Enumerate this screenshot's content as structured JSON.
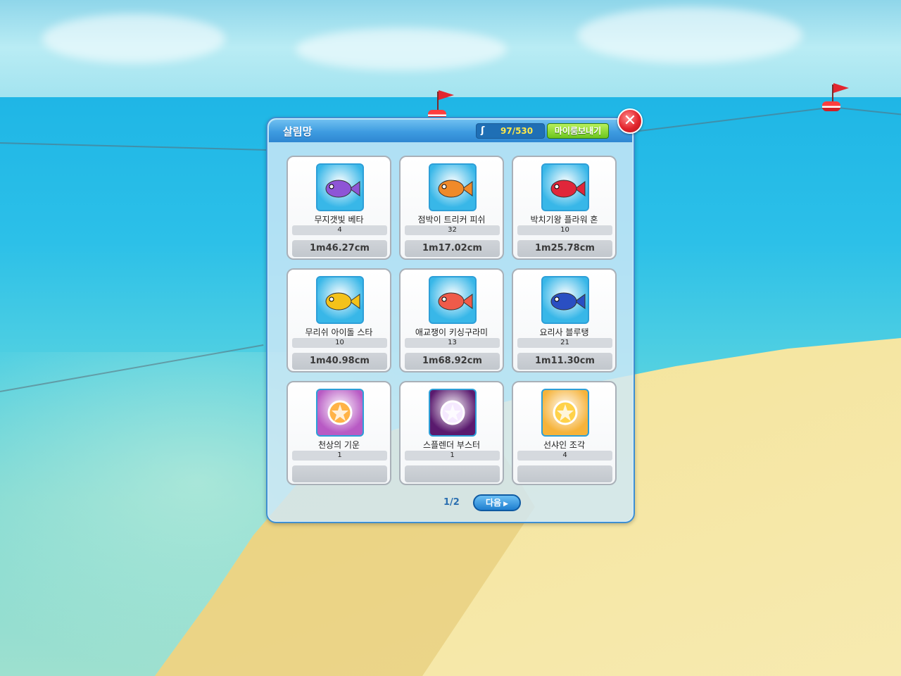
{
  "dialog": {
    "title": "살림망",
    "counter_icon": "hook-icon",
    "counter_text": "97/530",
    "send_button_label": "마이룸보내기",
    "close_icon": "close-icon"
  },
  "items": [
    {
      "name": "무지갯빛 베타",
      "count": "4",
      "size": "1m46.27cm",
      "icon": "betta-fish-icon",
      "bg": "#38b7e8",
      "fish": "#8e55d6"
    },
    {
      "name": "점박이 트리커 피쉬",
      "count": "32",
      "size": "1m17.02cm",
      "icon": "trigger-fish-icon",
      "bg": "#38b7e8",
      "fish": "#f08a2a"
    },
    {
      "name": "박치기왕 플라워 혼",
      "count": "10",
      "size": "1m25.78cm",
      "icon": "flowerhorn-fish-icon",
      "bg": "#38b7e8",
      "fish": "#e0263a"
    },
    {
      "name": "무리쉬 아이돌 스타",
      "count": "10",
      "size": "1m40.98cm",
      "icon": "angelfish-icon",
      "bg": "#38b7e8",
      "fish": "#f4c21a"
    },
    {
      "name": "애교쟁이 키싱구라미",
      "count": "13",
      "size": "1m68.92cm",
      "icon": "kissing-gourami-icon",
      "bg": "#38b7e8",
      "fish": "#ef5b4a"
    },
    {
      "name": "요리사 블루탱",
      "count": "21",
      "size": "1m11.30cm",
      "icon": "blue-tang-icon",
      "bg": "#38b7e8",
      "fish": "#2a4fc2"
    },
    {
      "name": "천상의 기운",
      "count": "1",
      "size": "",
      "icon": "celestial-orb-icon",
      "bg": "#b85ac4",
      "fish": "#ffb347"
    },
    {
      "name": "스플렌더 부스터",
      "count": "1",
      "size": "",
      "icon": "wing-booster-icon",
      "bg": "#5a1a6e",
      "fish": "#f5e9ff"
    },
    {
      "name": "선샤인 조각",
      "count": "4",
      "size": "",
      "icon": "sunshine-piece-icon",
      "bg": "#f6b33a",
      "fish": "#ffd24a"
    }
  ],
  "pagination": {
    "label": "1/2",
    "next_label": "다음"
  }
}
